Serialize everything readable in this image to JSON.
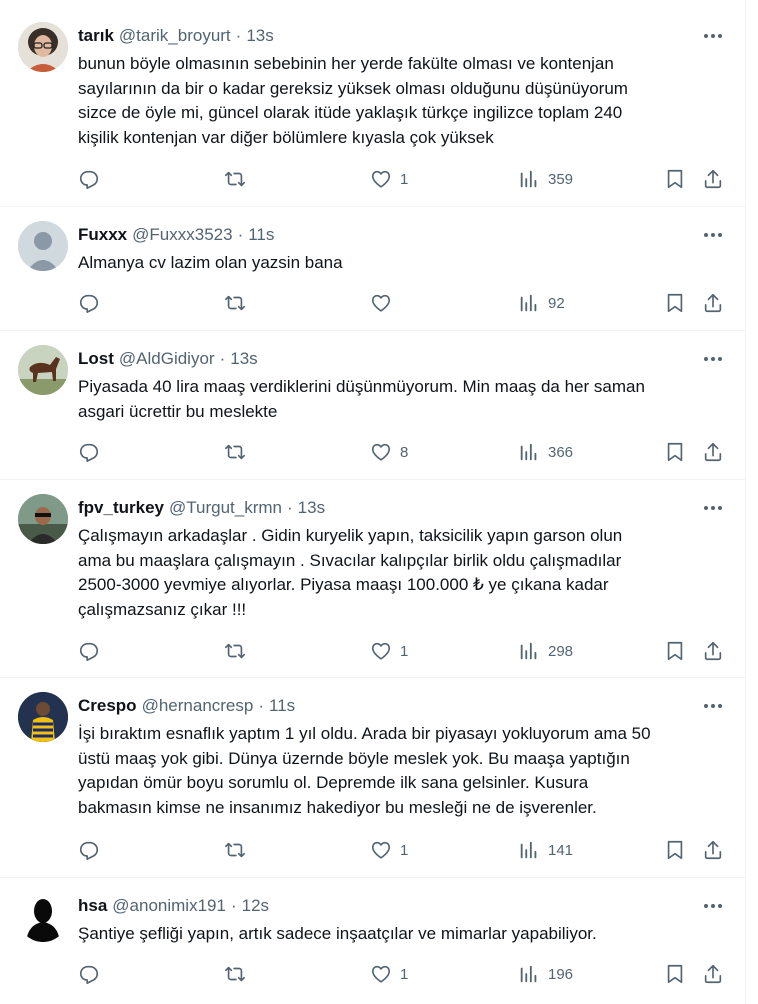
{
  "tweets": [
    {
      "name": "tarık",
      "handle": "@tarik_broyurt",
      "time": "13s",
      "text": [
        "bunun böyle olmasının sebebinin her yerde fakülte olması ve kontenjan",
        "sayılarının da bir o kadar gereksiz yüksek olması olduğunu düşünüyorum",
        "sizce de öyle mi, güncel olarak itüde yaklaşık türkçe ingilizce toplam 240",
        "kişilik kontenjan var diğer bölümlere kıyasla çok yüksek"
      ],
      "likes": "1",
      "views": "359"
    },
    {
      "name": "Fuxxx",
      "handle": "@Fuxxx3523",
      "time": "11s",
      "text": [
        "Almanya cv lazim olan yazsin bana"
      ],
      "likes": "",
      "views": "92"
    },
    {
      "name": "Lost",
      "handle": "@AldGidiyor",
      "time": "13s",
      "text": [
        "Piyasada 40 lira maaş verdiklerini düşünmüyorum. Min maaş da her saman",
        "asgari ücrettir bu meslekte"
      ],
      "likes": "8",
      "views": "366"
    },
    {
      "name": "fpv_turkey",
      "handle": "@Turgut_krmn",
      "time": "13s",
      "text": [
        "Çalışmayın arkadaşlar . Gidin kuryelik yapın, taksicilik yapın garson olun",
        "ama bu maaşlara çalışmayın . Sıvacılar kalıpçılar birlik oldu çalışmadılar",
        "2500-3000 yevmiye alıyorlar. Piyasa maaşı 100.000 ₺ ye çıkana kadar",
        "çalışmazsanız çıkar !!!"
      ],
      "likes": "1",
      "views": "298"
    },
    {
      "name": "Crespo",
      "handle": "@hernancresp",
      "time": "11s",
      "text": [
        "İşi bıraktım esnaflık yaptım 1 yıl oldu. Arada bir piyasayı yokluyorum ama 50",
        "üstü maaş yok gibi. Dünya üzernde böyle meslek yok. Bu maaşa yaptığın",
        "yapıdan ömür boyu sorumlu ol. Depremde ilk sana gelsinler. Kusura",
        "bakmasın kimse ne insanımız hakediyor bu mesleği ne de işverenler."
      ],
      "likes": "1",
      "views": "141"
    },
    {
      "name": "hsa",
      "handle": "@anonimix191",
      "time": "12s",
      "text": [
        "Şantiye şefliği yapın, artık sadece inşaatçılar ve mimarlar yapabiliyor."
      ],
      "likes": "1",
      "views": "196"
    }
  ],
  "ui": {
    "separator": "·",
    "icons": [
      "more-icon",
      "reply-icon",
      "retweet-icon",
      "like-icon",
      "views-icon",
      "bookmark-icon",
      "share-icon"
    ]
  }
}
